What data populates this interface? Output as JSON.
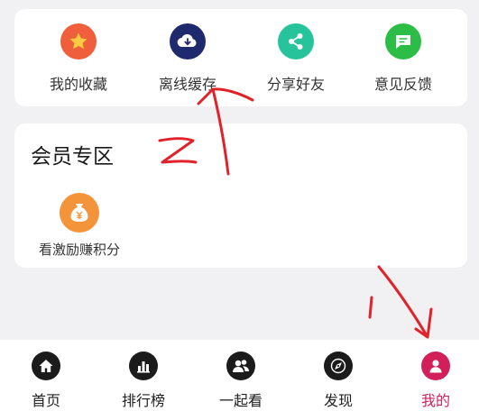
{
  "quick_actions": [
    {
      "label": "我的收藏",
      "icon": "star-icon",
      "color": "#f05f3b"
    },
    {
      "label": "离线缓存",
      "icon": "cloud-download-icon",
      "color": "#1f2a6e"
    },
    {
      "label": "分享好友",
      "icon": "share-icon",
      "color": "#27c39a"
    },
    {
      "label": "意见反馈",
      "icon": "feedback-icon",
      "color": "#2bbd45"
    }
  ],
  "vip_section": {
    "title": "会员专区",
    "items": [
      {
        "label": "看激励赚积分",
        "icon": "money-bag-icon",
        "color": "#f4943a"
      }
    ]
  },
  "tabbar": {
    "active_color": "#d21f5a",
    "tabs": [
      {
        "label": "首页",
        "icon": "home-icon",
        "active": false
      },
      {
        "label": "排行榜",
        "icon": "ranking-icon",
        "active": false
      },
      {
        "label": "一起看",
        "icon": "watch-together-icon",
        "active": false
      },
      {
        "label": "发现",
        "icon": "compass-icon",
        "active": false
      },
      {
        "label": "我的",
        "icon": "profile-icon",
        "active": true
      }
    ]
  },
  "annotations": {
    "color": "#e0232b",
    "marks": [
      "arrow",
      "2",
      "arrow"
    ]
  }
}
